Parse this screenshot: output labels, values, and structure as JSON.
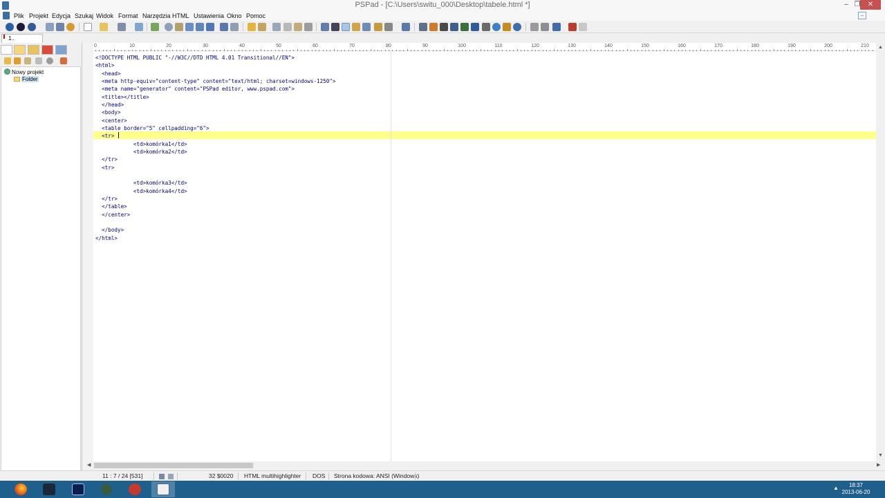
{
  "window": {
    "title": "PSPad - [C:\\Users\\switu_000\\Desktop\\tabele.html *]",
    "minimize_icon": "minimize-icon",
    "maximize_icon": "maximize-icon",
    "close_icon": "close-icon"
  },
  "menu": {
    "items": [
      "Plik",
      "Projekt",
      "Edycja",
      "Szukaj",
      "Widok",
      "Format",
      "Narzędzia",
      "HTML",
      "Ustawienia",
      "Okno",
      "Pomoc"
    ]
  },
  "tabs": [
    {
      "label": "1.. tabele.html",
      "modified": true
    }
  ],
  "project_tree": {
    "root": "Nowy projekt",
    "folder": "Folder"
  },
  "ruler": {
    "labels": [
      "0",
      "10",
      "20",
      "30",
      "40",
      "50",
      "60",
      "70",
      "80",
      "90",
      "100",
      "110",
      "120",
      "130",
      "140",
      "150",
      "160",
      "170",
      "180",
      "190",
      "200",
      "210"
    ]
  },
  "editor": {
    "lines": [
      "<!DOCTYPE HTML PUBLIC \"-//W3C//DTD HTML 4.01 Transitional//EN\">",
      "<html>",
      "  <head>",
      "  <meta http-equiv=\"content-type\" content=\"text/html; charset=windows-1250\">",
      "  <meta name=\"generator\" content=\"PSPad editor, www.pspad.com\">",
      "  <title></title>",
      "  </head>",
      "  <body>",
      "  <center>",
      "  <table border=\"5\" cellpadding=\"6\">",
      "  <tr>",
      "            <td>komórka1</td>",
      "            <td>komórka2</td>",
      "  </tr>",
      "  <tr>",
      "",
      "            <td>komórka3</td>",
      "            <td>komórka4</td>",
      "  </tr>",
      "  </table>",
      "  </center>",
      "",
      "  </body>",
      "</html>"
    ],
    "current_line": 11
  },
  "status": {
    "position": "11 : 7 / 24  [531]",
    "char_code": "32  $0020",
    "highlighter": "HTML multihighlighter",
    "line_endings": "DOS",
    "codepage": "Strona kodowa: ANSI (Windows)"
  },
  "taskbar": {
    "apps": [
      "firefox-icon",
      "steam-icon",
      "editor-l-icon",
      "app-diamond-icon",
      "app-car-icon",
      "pspad-icon"
    ],
    "time": "18:37",
    "date": "2013-06-20"
  },
  "colors": {
    "tag": "#00007f",
    "current_line": "#ffff88",
    "taskbar": "#1f5f8b"
  }
}
